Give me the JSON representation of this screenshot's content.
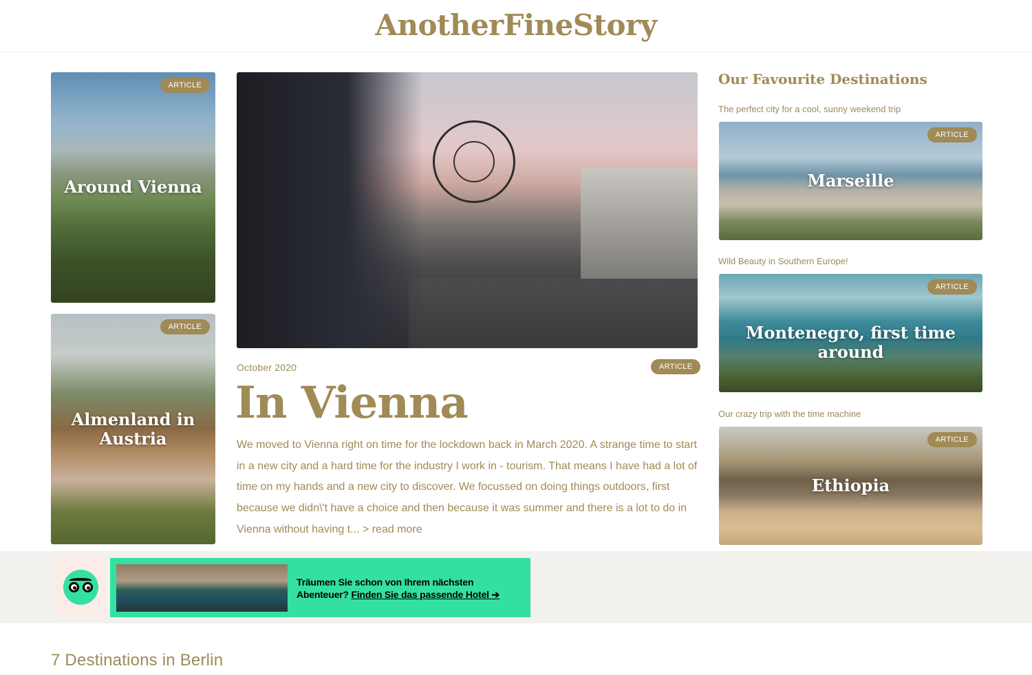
{
  "site": {
    "logo": "AnotherFineStory"
  },
  "left_cards": [
    {
      "title": "Around Vienna",
      "badge": "ARTICLE"
    },
    {
      "title": "Almenland in Austria",
      "badge": "ARTICLE"
    }
  ],
  "featured": {
    "badge": "ARTICLE",
    "date": "October 2020",
    "title": "In Vienna",
    "excerpt": "We moved to Vienna right on time for the lockdown back in March 2020. A strange time to start in a new city and a hard time for the industry I work in - tourism. That means I have had a lot of time on my hands and a new city to discover. We focussed on doing things outdoors, first because we didn\\'t have a choice and then because it was summer and there is a lot to do in Vienna without having t... ",
    "read_more": "> read more"
  },
  "sidebar": {
    "heading": "Our Favourite Destinations",
    "items": [
      {
        "subtitle": "The perfect city for a cool, sunny weekend trip",
        "title": "Marseille",
        "badge": "ARTICLE"
      },
      {
        "subtitle": "Wild Beauty in Southern Europe!",
        "title": "Montenegro, first time around",
        "badge": "ARTICLE"
      },
      {
        "subtitle": "Our crazy trip with the time machine",
        "title": "Ethiopia",
        "badge": "ARTICLE"
      }
    ]
  },
  "ad": {
    "text": "Träumen Sie schon von Ihrem nächsten Abenteuer? ",
    "link": "Finden Sie das passende Hotel ➔",
    "logo_icon": "tripadvisor-owl-icon",
    "brand_color": "#34e0a1"
  },
  "section": {
    "title": "7 Destinations in Berlin"
  },
  "colors": {
    "accent": "#a08a56",
    "ad_band": "#f3f1ed"
  }
}
